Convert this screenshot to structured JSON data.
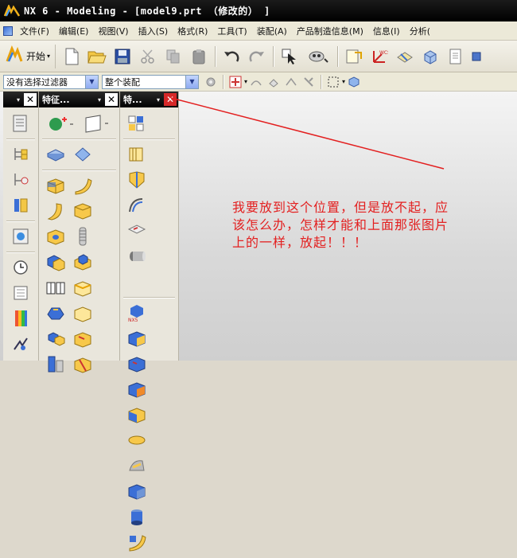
{
  "window": {
    "title": "NX 6 - Modeling - [model9.prt （修改的） ]"
  },
  "menubar": {
    "items": [
      {
        "label": "文件(F)",
        "name": "menu-file"
      },
      {
        "label": "编辑(E)",
        "name": "menu-edit"
      },
      {
        "label": "视图(V)",
        "name": "menu-view"
      },
      {
        "label": "插入(S)",
        "name": "menu-insert"
      },
      {
        "label": "格式(R)",
        "name": "menu-format"
      },
      {
        "label": "工具(T)",
        "name": "menu-tools"
      },
      {
        "label": "装配(A)",
        "name": "menu-assembly"
      },
      {
        "label": "产品制造信息(M)",
        "name": "menu-pmi"
      },
      {
        "label": "信息(I)",
        "name": "menu-info"
      },
      {
        "label": "分析(",
        "name": "menu-analysis"
      }
    ]
  },
  "toolbar": {
    "start_label": "开始"
  },
  "selection": {
    "filter_value": "没有选择过滤器",
    "scope_value": "整个装配"
  },
  "panels": {
    "panel1": {
      "title": ""
    },
    "panel2": {
      "title": "特征..."
    },
    "panel3": {
      "title": "特..."
    }
  },
  "annotation": {
    "line1": "我要放到这个位置，但是放不起，应",
    "line2": "该怎么办，怎样才能和上面那张图片",
    "line3": "上的一样，放起！！！"
  },
  "colors": {
    "annotation": "#e32020",
    "title_bg": "#000000",
    "close_active": "#d62828"
  }
}
